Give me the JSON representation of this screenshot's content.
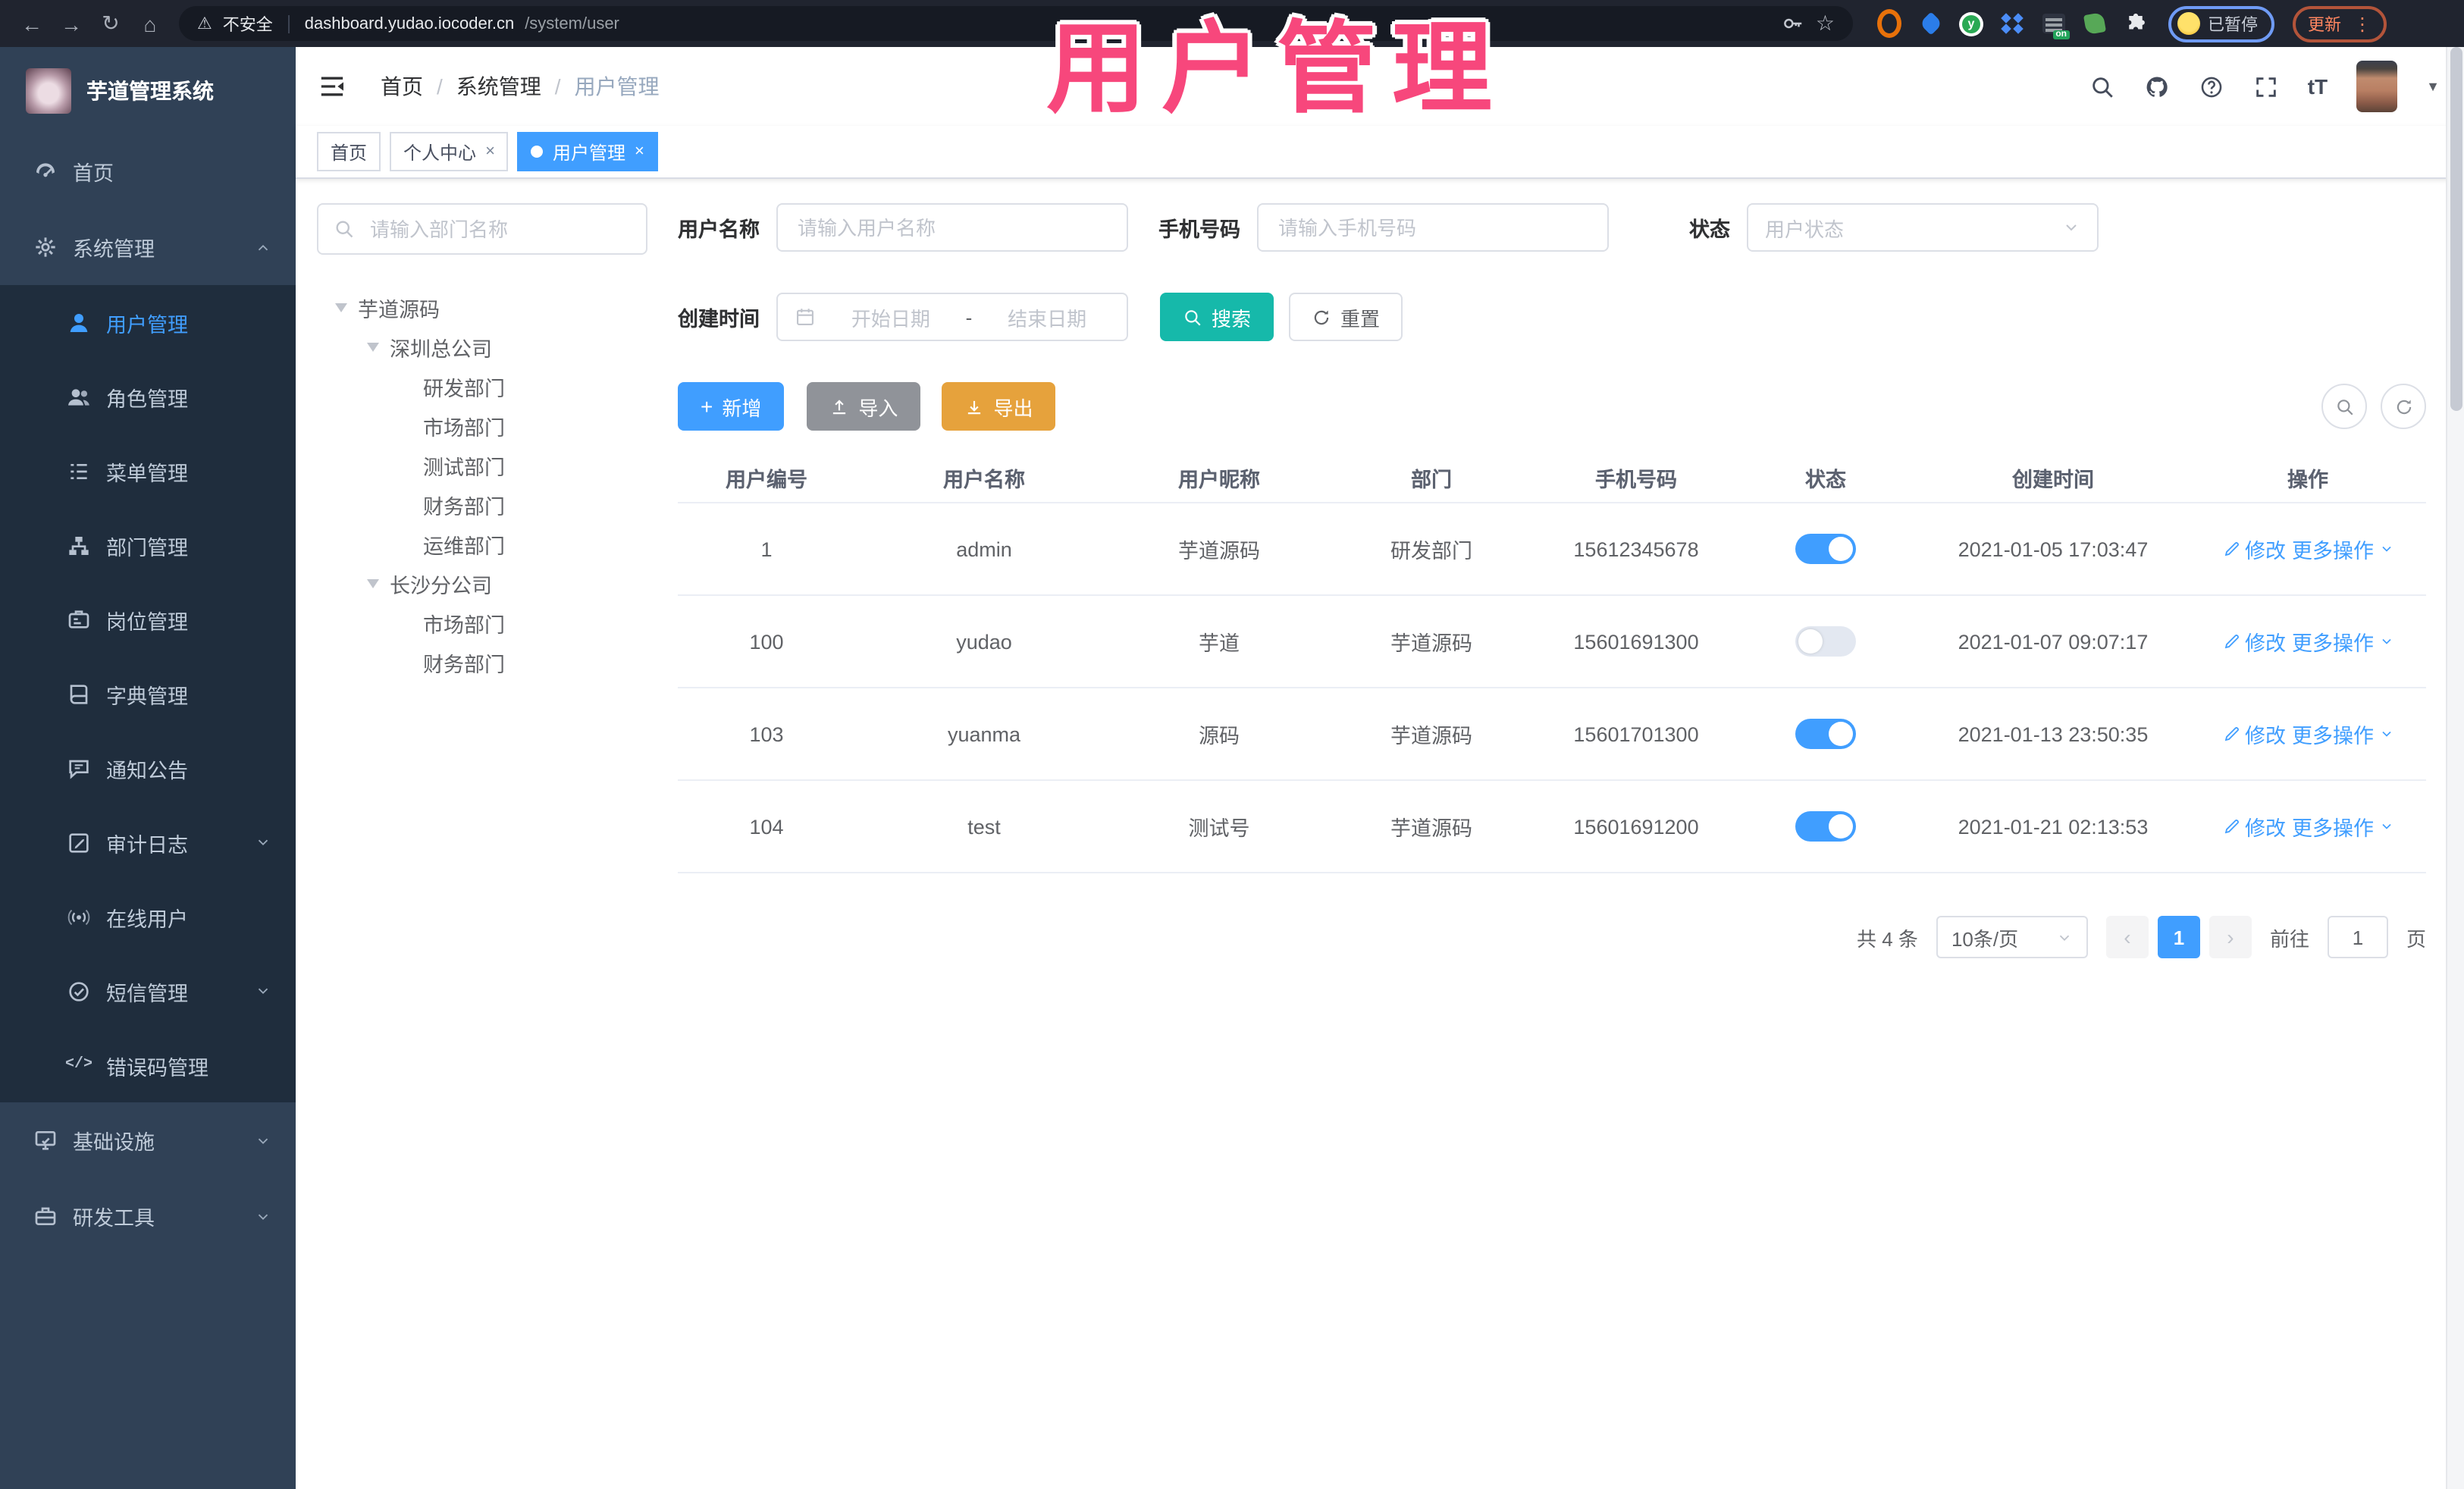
{
  "colors": {
    "primary": "#409eff",
    "success": "#16b9aa",
    "warning": "#e6a23c",
    "info": "#909399",
    "annotation": "#f7477c",
    "sidebar": "#304156",
    "submenu": "#1f2d3d"
  },
  "browser": {
    "security_label": "不安全",
    "url_host": "dashboard.yudao.iocoder.cn",
    "url_path": "/system/user",
    "extensions": [
      "orange-circle",
      "blue-drop",
      "green-y",
      "blue-grid",
      "list-on-badge",
      "green-leaf",
      "puzzle"
    ],
    "profile_label": "已暂停",
    "update_label": "更新"
  },
  "annotation": {
    "text": "用户管理"
  },
  "app": {
    "logo_title": "芋道管理系统",
    "breadcrumb": {
      "items": [
        "首页",
        "系统管理",
        "用户管理"
      ]
    },
    "tabs": [
      {
        "label": "首页",
        "closable": false,
        "active": false
      },
      {
        "label": "个人中心",
        "closable": true,
        "active": false
      },
      {
        "label": "用户管理",
        "closable": true,
        "active": true
      }
    ]
  },
  "sidebar": {
    "menu": [
      {
        "key": "home",
        "label": "首页",
        "icon": "dashboard",
        "level": 0
      },
      {
        "key": "system-mgmt",
        "label": "系统管理",
        "icon": "gear",
        "level": 0,
        "arrow": "up"
      },
      {
        "key": "user-mgmt",
        "label": "用户管理",
        "icon": "user",
        "level": 1,
        "active": true
      },
      {
        "key": "role-mgmt",
        "label": "角色管理",
        "icon": "users",
        "level": 1
      },
      {
        "key": "menu-mgmt",
        "label": "菜单管理",
        "icon": "menu",
        "level": 1
      },
      {
        "key": "dept-mgmt",
        "label": "部门管理",
        "icon": "tree",
        "level": 1
      },
      {
        "key": "post-mgmt",
        "label": "岗位管理",
        "icon": "badge",
        "level": 1
      },
      {
        "key": "dict-mgmt",
        "label": "字典管理",
        "icon": "book",
        "level": 1
      },
      {
        "key": "notice",
        "label": "通知公告",
        "icon": "comment",
        "level": 1
      },
      {
        "key": "audit-log",
        "label": "审计日志",
        "icon": "editlog",
        "level": 1,
        "arrow": "down"
      },
      {
        "key": "online-users",
        "label": "在线用户",
        "icon": "online",
        "level": 1
      },
      {
        "key": "sms-mgmt",
        "label": "短信管理",
        "icon": "msgcheck",
        "level": 1,
        "arrow": "down"
      },
      {
        "key": "errcode-mgmt",
        "label": "错误码管理",
        "icon": "code",
        "level": 1
      },
      {
        "key": "infrastructure",
        "label": "基础设施",
        "icon": "infra",
        "level": 0,
        "arrow": "down"
      },
      {
        "key": "dev-tools",
        "label": "研发工具",
        "icon": "tools",
        "level": 0,
        "arrow": "down"
      }
    ]
  },
  "dept_panel": {
    "search_placeholder": "请输入部门名称",
    "tree": [
      {
        "label": "芋道源码",
        "level": 0,
        "caret": true
      },
      {
        "label": "深圳总公司",
        "level": 1,
        "caret": true
      },
      {
        "label": "研发部门",
        "level": 2,
        "caret": false
      },
      {
        "label": "市场部门",
        "level": 2,
        "caret": false
      },
      {
        "label": "测试部门",
        "level": 2,
        "caret": false
      },
      {
        "label": "财务部门",
        "level": 2,
        "caret": false
      },
      {
        "label": "运维部门",
        "level": 2,
        "caret": false
      },
      {
        "label": "长沙分公司",
        "level": 1,
        "caret": true
      },
      {
        "label": "市场部门",
        "level": 2,
        "caret": false
      },
      {
        "label": "财务部门",
        "level": 2,
        "caret": false
      }
    ]
  },
  "filters": {
    "username_label": "用户名称",
    "username_placeholder": "请输入用户名称",
    "mobile_label": "手机号码",
    "mobile_placeholder": "请输入手机号码",
    "status_label": "状态",
    "status_placeholder": "用户状态",
    "created_label": "创建时间",
    "date_start_placeholder": "开始日期",
    "date_separator": "-",
    "date_end_placeholder": "结束日期",
    "search_label": "搜索",
    "reset_label": "重置"
  },
  "toolbar": {
    "add_label": "新增",
    "import_label": "导入",
    "export_label": "导出"
  },
  "table": {
    "columns": [
      "用户编号",
      "用户名称",
      "用户昵称",
      "部门",
      "手机号码",
      "状态",
      "创建时间",
      "操作"
    ],
    "rows": [
      {
        "id": "1",
        "username": "admin",
        "nickname": "芋道源码",
        "dept": "研发部门",
        "mobile": "15612345678",
        "status_on": true,
        "created": "2021-01-05 17:03:47",
        "actions": [
          "修改",
          "更多操作"
        ]
      },
      {
        "id": "100",
        "username": "yudao",
        "nickname": "芋道",
        "dept": "芋道源码",
        "mobile": "15601691300",
        "status_on": false,
        "created": "2021-01-07 09:07:17",
        "actions": [
          "修改",
          "更多操作"
        ]
      },
      {
        "id": "103",
        "username": "yuanma",
        "nickname": "源码",
        "dept": "芋道源码",
        "mobile": "15601701300",
        "status_on": true,
        "created": "2021-01-13 23:50:35",
        "actions": [
          "修改",
          "更多操作"
        ]
      },
      {
        "id": "104",
        "username": "test",
        "nickname": "测试号",
        "dept": "芋道源码",
        "mobile": "15601691200",
        "status_on": true,
        "created": "2021-01-21 02:13:53",
        "actions": [
          "修改",
          "更多操作"
        ]
      }
    ]
  },
  "pagination": {
    "total": "共 4 条",
    "page_size": "10条/页",
    "page": "1",
    "goto": "前往",
    "unit": "页"
  }
}
